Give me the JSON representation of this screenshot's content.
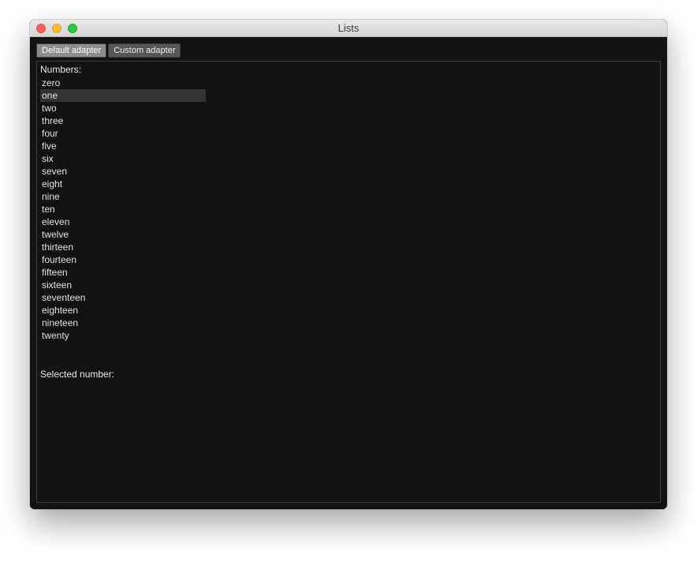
{
  "window": {
    "title": "Lists"
  },
  "tabs": [
    {
      "label": "Default adapter",
      "active": true
    },
    {
      "label": "Custom adapter",
      "active": false
    }
  ],
  "numbers_label": "Numbers:",
  "numbers": {
    "items": [
      "zero",
      "one",
      "two",
      "three",
      "four",
      "five",
      "six",
      "seven",
      "eight",
      "nine",
      "ten",
      "eleven",
      "twelve",
      "thirteen",
      "fourteen",
      "fifteen",
      "sixteen",
      "seventeen",
      "eighteen",
      "nineteen",
      "twenty"
    ],
    "selected_index": 1
  },
  "selected_label": "Selected number:",
  "selected_value": ""
}
